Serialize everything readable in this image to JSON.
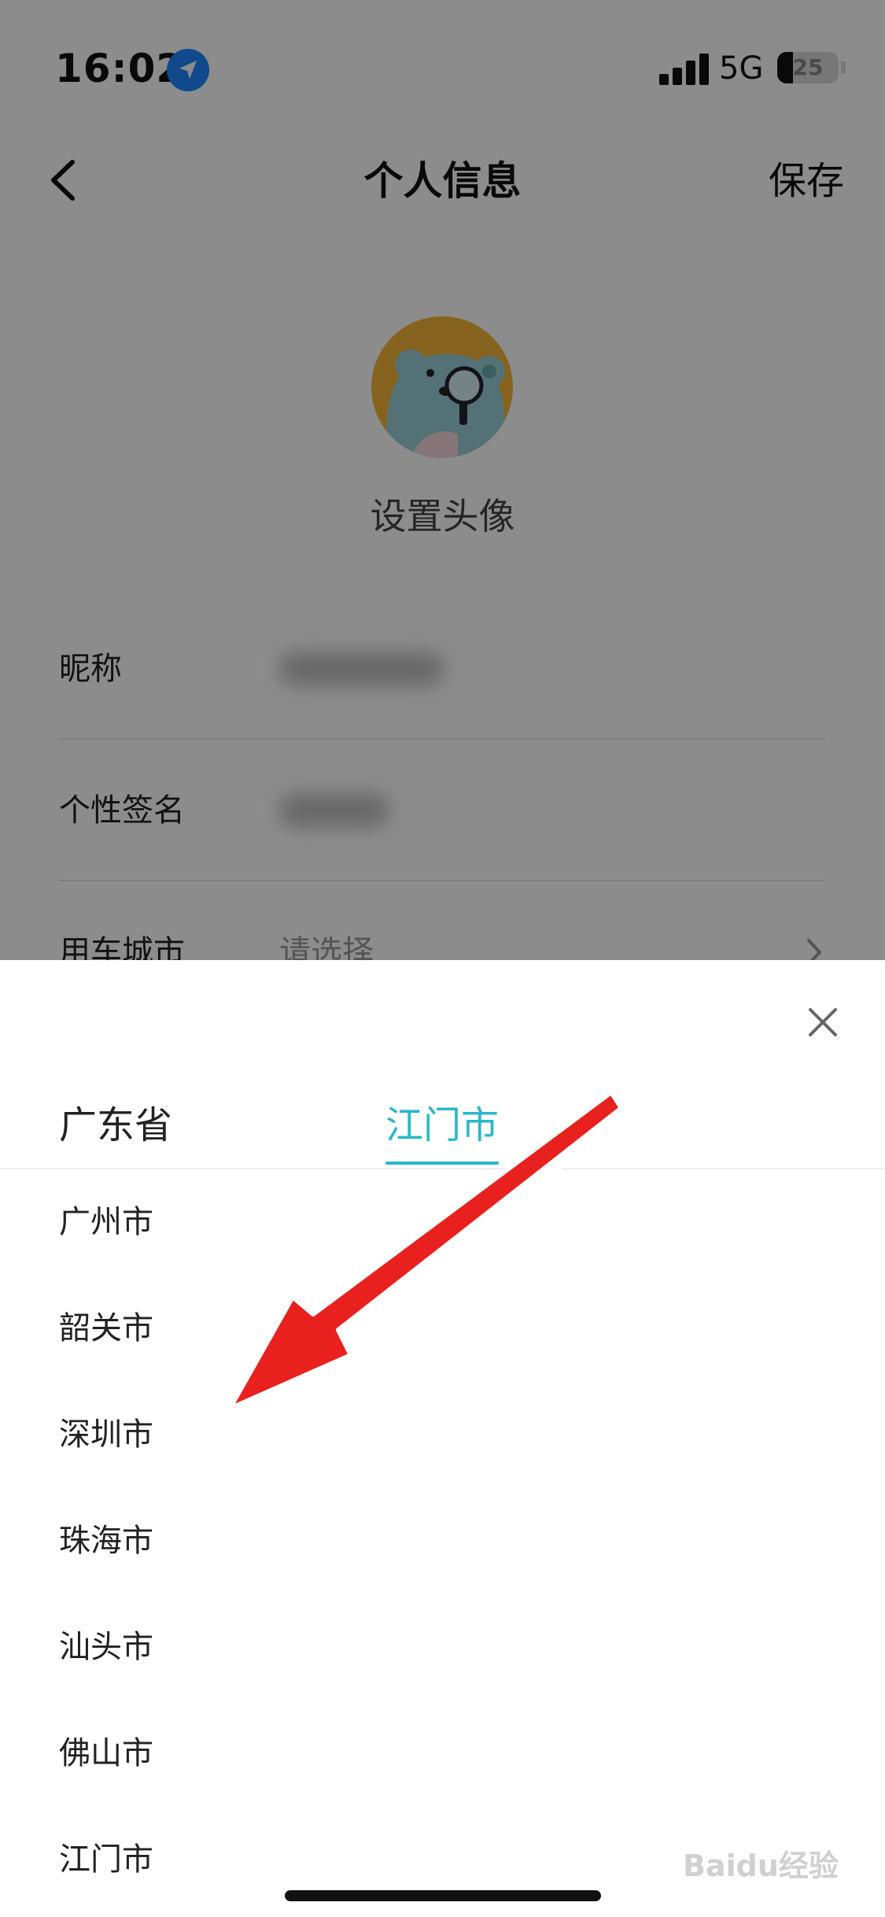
{
  "status_bar": {
    "time": "16:02",
    "network": "5G",
    "battery": "25",
    "battery_level": 0.25,
    "location_icon": "location-arrow-icon"
  },
  "nav": {
    "back_icon": "chevron-left-icon",
    "title": "个人信息",
    "save_label": "保存"
  },
  "profile": {
    "avatar_icon": "bear-avatar-icon",
    "avatar_label": "设置头像"
  },
  "form": {
    "nickname_label": "昵称",
    "signature_label": "个性签名",
    "city_label": "用车城市",
    "city_placeholder": "请选择"
  },
  "sheet": {
    "close_icon": "close-icon",
    "tabs": [
      {
        "label": "广东省",
        "selected": false
      },
      {
        "label": "江门市",
        "selected": true
      }
    ],
    "cities": [
      "广州市",
      "韶关市",
      "深圳市",
      "珠海市",
      "汕头市",
      "佛山市",
      "江门市"
    ]
  },
  "watermark": "Baidu经验",
  "colors": {
    "accent": "#2bb7c8",
    "annotation_arrow": "#e8201e",
    "location_badge": "#1e88ff"
  }
}
